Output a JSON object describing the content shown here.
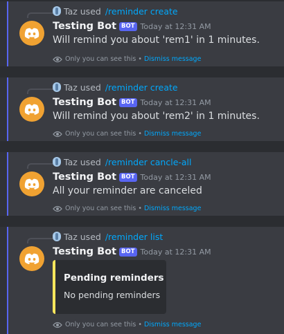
{
  "messages": [
    {
      "invoker": "Taz used",
      "command": "/reminder create",
      "bot_name": "Testing Bot",
      "badge": "BOT",
      "time": "Today at 12:31 AM",
      "content": "Will remind you about 'rem1' in 1 minutes.",
      "ephemeral_note": "Only you can see this",
      "separator": "•",
      "dismiss": "Dismiss message"
    },
    {
      "invoker": "Taz used",
      "command": "/reminder create",
      "bot_name": "Testing Bot",
      "badge": "BOT",
      "time": "Today at 12:31 AM",
      "content": "Will remind you about 'rem2' in 1 minutes.",
      "ephemeral_note": "Only you can see this",
      "separator": "•",
      "dismiss": "Dismiss message"
    },
    {
      "invoker": "Taz used",
      "command": "/reminder cancle-all",
      "bot_name": "Testing Bot",
      "badge": "BOT",
      "time": "Today at 12:31 AM",
      "content": "All your reminder are canceled",
      "ephemeral_note": "Only you can see this",
      "separator": "•",
      "dismiss": "Dismiss message"
    },
    {
      "invoker": "Taz used",
      "command": "/reminder list",
      "bot_name": "Testing Bot",
      "badge": "BOT",
      "time": "Today at 12:31 AM",
      "embed": {
        "title": "Pending reminders",
        "description": "No pending reminders",
        "accent_color": "#fee75c"
      },
      "ephemeral_note": "Only you can see this",
      "separator": "•",
      "dismiss": "Dismiss message"
    }
  ],
  "colors": {
    "background": "#313338",
    "ephemeral_background": "#3a3c42",
    "accent_bar": "#5865f2",
    "link": "#00a8fc",
    "avatar": "#f0a232"
  },
  "icons": {
    "avatar": "discord-logo-icon",
    "command": "app-icon",
    "ephemeral": "eye-icon"
  }
}
